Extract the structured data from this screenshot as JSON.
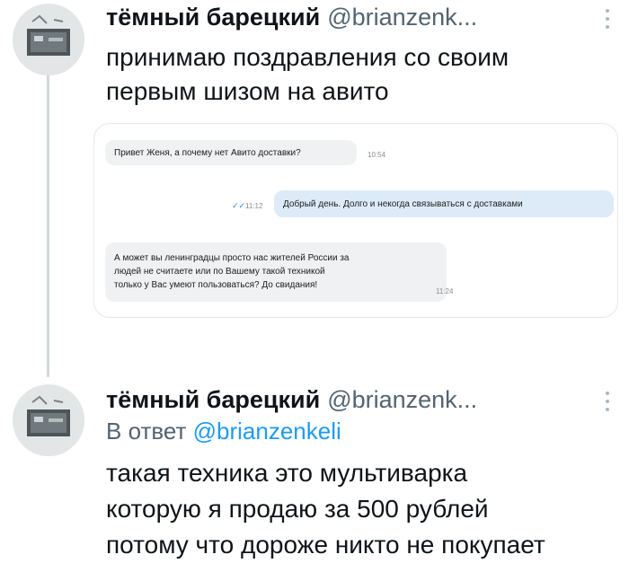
{
  "tweets": [
    {
      "name": "тёмный барецкий",
      "handle": "@brianzenk...",
      "text_lines": [
        "принимаю поздравления со своим",
        "первым шизом на авито"
      ]
    },
    {
      "name": "тёмный барецкий",
      "handle": "@brianzenk...",
      "reply_prefix": "В ответ",
      "reply_handle": "@brianzenkeli",
      "text_lines": [
        "такая техника это мультиварка",
        "которую я продаю за 500 рублей",
        "потому что дороже никто не покупает"
      ]
    }
  ],
  "chat": {
    "msg1": "Привет Женя, а почему нет Авито доставки?",
    "msg1_time": "10:54",
    "msg2": "Добрый день. Долго и некогда связываться с доставками",
    "msg2_time": "11:12",
    "msg3_lines": [
      "А может вы ленинградцы просто нас жителей России за",
      "людей не считаете или по Вашему такой техникой",
      "только у Вас умеют пользоваться? До свидания!"
    ],
    "msg3_time": "11:24"
  },
  "icons": {
    "more": "more-vertical-icon",
    "read": "double-check-icon"
  },
  "colors": {
    "link": "#1d9bf0",
    "muted": "#536471",
    "thread_line": "#cfd9de"
  }
}
